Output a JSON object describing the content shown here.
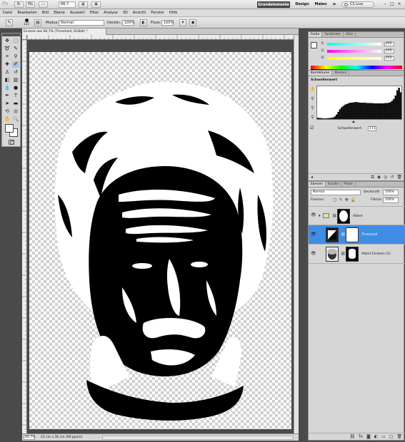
{
  "appbar": {
    "logo": "Ps",
    "zoom": "66,7",
    "workspaces": [
      "Grundelemente",
      "Design",
      "Malen"
    ],
    "more": "»",
    "cslive": "CS Live",
    "win": [
      "–",
      "□",
      "×"
    ]
  },
  "menu": [
    "Datei",
    "Bearbeiten",
    "Bild",
    "Ebene",
    "Auswahl",
    "Filter",
    "Analyse",
    "3D",
    "Ansicht",
    "Fenster",
    "Hilfe"
  ],
  "options": {
    "brush_size": "125",
    "mode_label": "Modus:",
    "mode_value": "Normal",
    "opacity_label": "Deckkr.:",
    "opacity_value": "100%",
    "flow_label": "Fluss:",
    "flow_value": "100%"
  },
  "document": {
    "tab_title": "Einstein bei 66,7% (Threshold, RGB/8) *",
    "status_zoom": "66,7%",
    "status_info": "21 cm x 30 cm (90 ppcm)"
  },
  "color_panel": {
    "tabs": [
      "Farbe",
      "Farbfelder",
      "Stile"
    ],
    "channels": [
      {
        "name": "R",
        "value": "255"
      },
      {
        "name": "G",
        "value": "255"
      },
      {
        "name": "B",
        "value": "255"
      }
    ]
  },
  "adjust_panel": {
    "tabs": [
      "Korrekturen",
      "Masken"
    ],
    "title": "Schwellenwert",
    "threshold_label": "Schwellenwert:",
    "threshold_value": "171",
    "histogram": [
      4,
      3,
      3,
      2,
      2,
      2,
      3,
      3,
      4,
      5,
      8,
      14,
      22,
      30,
      36,
      40,
      44,
      46,
      48,
      50,
      50,
      51,
      52,
      52,
      51,
      50,
      50,
      50,
      50,
      49,
      49,
      49,
      49,
      48,
      48,
      48,
      48,
      48,
      48,
      48,
      49,
      49,
      50,
      52,
      56,
      62,
      72,
      88,
      96,
      82
    ]
  },
  "layers_panel": {
    "tabs": [
      "Ebenen",
      "Kanäle",
      "Pfade"
    ],
    "blend_mode": "Normal",
    "opacity_label": "Deckkraft:",
    "opacity_value": "100%",
    "fix_label": "Fixieren:",
    "fill_label": "Fläche:",
    "fill_value": "100%",
    "layers": [
      {
        "name": "Albert",
        "type": "group"
      },
      {
        "name": "Threshold",
        "type": "adjustment",
        "selected": true
      },
      {
        "name": "Albert Einstein (1)",
        "type": "image"
      }
    ]
  },
  "colors": {
    "accent": "#3f8de4",
    "panel": "#d6d6d6",
    "pasteboard": "#4a4a4a"
  }
}
